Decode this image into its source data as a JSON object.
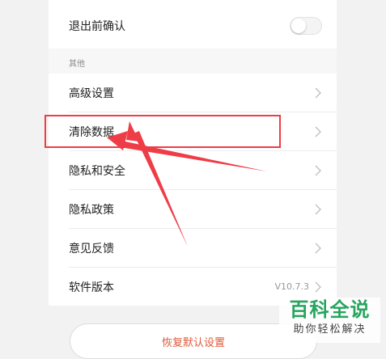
{
  "settings": {
    "exit_confirm": {
      "label": "退出前确认",
      "enabled": false
    },
    "section_other": "其他",
    "items": [
      {
        "label": "高级设置"
      },
      {
        "label": "清除数据"
      },
      {
        "label": "隐私和安全"
      },
      {
        "label": "隐私政策"
      },
      {
        "label": "意见反馈"
      },
      {
        "label": "软件版本",
        "value": "V10.7.3"
      }
    ],
    "restore_button": "恢复默认设置"
  },
  "watermark": {
    "title": "百科全说",
    "subtitle": "助你轻松解决"
  },
  "colors": {
    "annotation": "#ee3d46",
    "watermark": "#26a55e",
    "restore_text": "#e05a3a"
  }
}
